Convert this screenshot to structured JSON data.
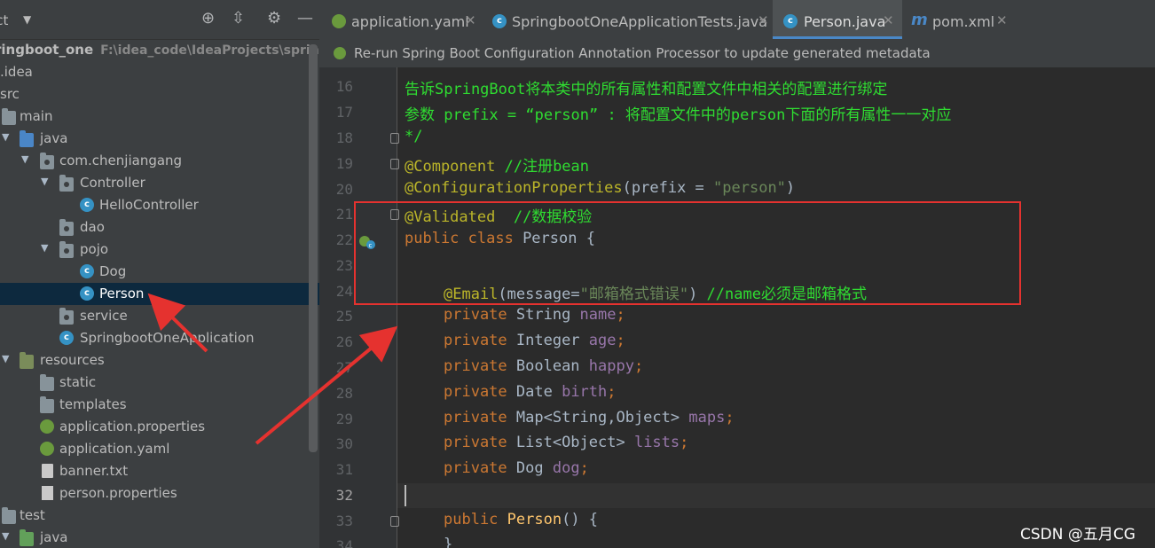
{
  "project": {
    "title": "ect",
    "items": [
      {
        "label": "ringboot_one",
        "path": "F:\\idea_code\\IdeaProjects\\springbo"
      },
      {
        "label": ".idea"
      },
      {
        "label": "src"
      },
      {
        "label": "main"
      },
      {
        "label": "java"
      },
      {
        "label": "com.chenjiangang"
      },
      {
        "label": "Controller"
      },
      {
        "label": "HelloController"
      },
      {
        "label": "dao"
      },
      {
        "label": "pojo"
      },
      {
        "label": "Dog"
      },
      {
        "label": "Person"
      },
      {
        "label": "service"
      },
      {
        "label": "SpringbootOneApplication"
      },
      {
        "label": "resources"
      },
      {
        "label": "static"
      },
      {
        "label": "templates"
      },
      {
        "label": "application.properties"
      },
      {
        "label": "application.yaml"
      },
      {
        "label": "banner.txt"
      },
      {
        "label": "person.properties"
      },
      {
        "label": "test"
      },
      {
        "label": "java"
      }
    ]
  },
  "tabs": [
    {
      "label": "application.yaml",
      "icon": "yaml-leaf-icon"
    },
    {
      "label": "SpringbootOneApplicationTests.java",
      "icon": "test-class-icon"
    },
    {
      "label": "Person.java",
      "icon": "class-icon",
      "active": true
    },
    {
      "label": "pom.xml",
      "icon": "maven-icon",
      "icon_text": "m"
    }
  ],
  "banner": {
    "text": "Re-run Spring Boot Configuration Annotation Processor to update generated metadata"
  },
  "editor": {
    "line_numbers": [
      "16",
      "17",
      "18",
      "19",
      "20",
      "21",
      "22",
      "23",
      "24",
      "25",
      "26",
      "27",
      "28",
      "29",
      "30",
      "31",
      "32",
      "33",
      "34"
    ],
    "lines": {
      "l16": "告诉SpringBoot将本类中的所有属性和配置文件中相关的配置进行绑定",
      "l17": "参数 prefix = “person” : 将配置文件中的person下面的所有属性一一对应",
      "l18": "*/",
      "l19a": "@Component",
      "l19b": " //注册bean",
      "l20a": "@ConfigurationProperties",
      "l20b": "(",
      "l20c": "prefix",
      "l20d": " = ",
      "l20e": "\"person\"",
      "l20f": ")",
      "l21a": "@Validated",
      "l21b": "  //数据校验",
      "l22a": "public class ",
      "l22b": "Person {",
      "l24a": "@Email",
      "l24b": "(",
      "l24c": "message",
      "l24d": "=",
      "l24e": "\"邮箱格式错误\"",
      "l24f": ") ",
      "l24g": "//name必须是邮箱格式",
      "l25a": "private ",
      "l25b": "String ",
      "l25c": "name",
      "l25d": ";",
      "l26a": "private ",
      "l26b": "Integer ",
      "l26c": "age",
      "l26d": ";",
      "l27a": "private ",
      "l27b": "Boolean ",
      "l27c": "happy",
      "l27d": ";",
      "l28a": "private ",
      "l28b": "Date ",
      "l28c": "birth",
      "l28d": ";",
      "l29a": "private ",
      "l29b": "Map<String,Object> ",
      "l29c": "maps",
      "l29d": ";",
      "l30a": "private ",
      "l30b": "List<Object> ",
      "l30c": "lists",
      "l30d": ";",
      "l31a": "private ",
      "l31b": "Dog ",
      "l31c": "dog",
      "l31d": ";",
      "l33a": "public ",
      "l33b": "Person",
      "l33c": "() {",
      "l34": "}"
    }
  },
  "watermark": "CSDN @五月CG",
  "colors": {
    "annotation_red": "#e5322f",
    "selection": "#0d293e",
    "accent": "#4a88c7"
  }
}
